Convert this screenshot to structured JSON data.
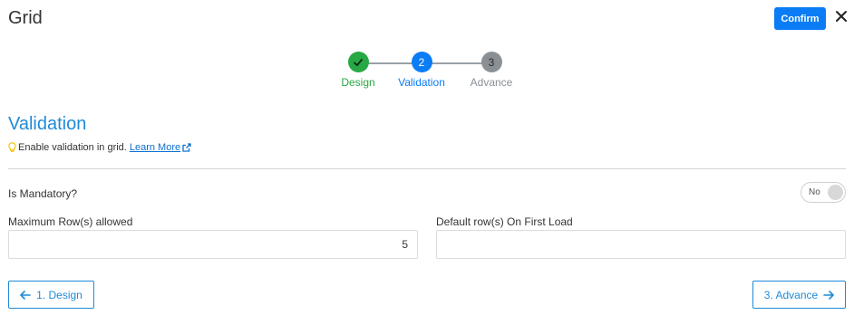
{
  "header": {
    "title": "Grid",
    "confirm_label": "Confirm"
  },
  "stepper": {
    "steps": [
      {
        "number": "1",
        "label": "Design",
        "state": "done",
        "color": "#27a844"
      },
      {
        "number": "2",
        "label": "Validation",
        "state": "active",
        "color": "#0a7cf5"
      },
      {
        "number": "3",
        "label": "Advance",
        "state": "pending",
        "color": "#8a9096"
      }
    ]
  },
  "section": {
    "title": "Validation",
    "hint_text": "Enable validation in grid.",
    "learn_more": "Learn More"
  },
  "form": {
    "mandatory_label": "Is Mandatory?",
    "mandatory_toggle": "No",
    "max_rows_label": "Maximum Row(s) allowed",
    "max_rows_value": "5",
    "default_rows_label": "Default row(s) On First Load",
    "default_rows_value": ""
  },
  "footer": {
    "prev_label": "1. Design",
    "next_label": "3. Advance"
  },
  "colors": {
    "accent": "#1f8ad8",
    "confirm": "#0a7cf5",
    "success": "#27a844",
    "muted": "#8a9096"
  }
}
